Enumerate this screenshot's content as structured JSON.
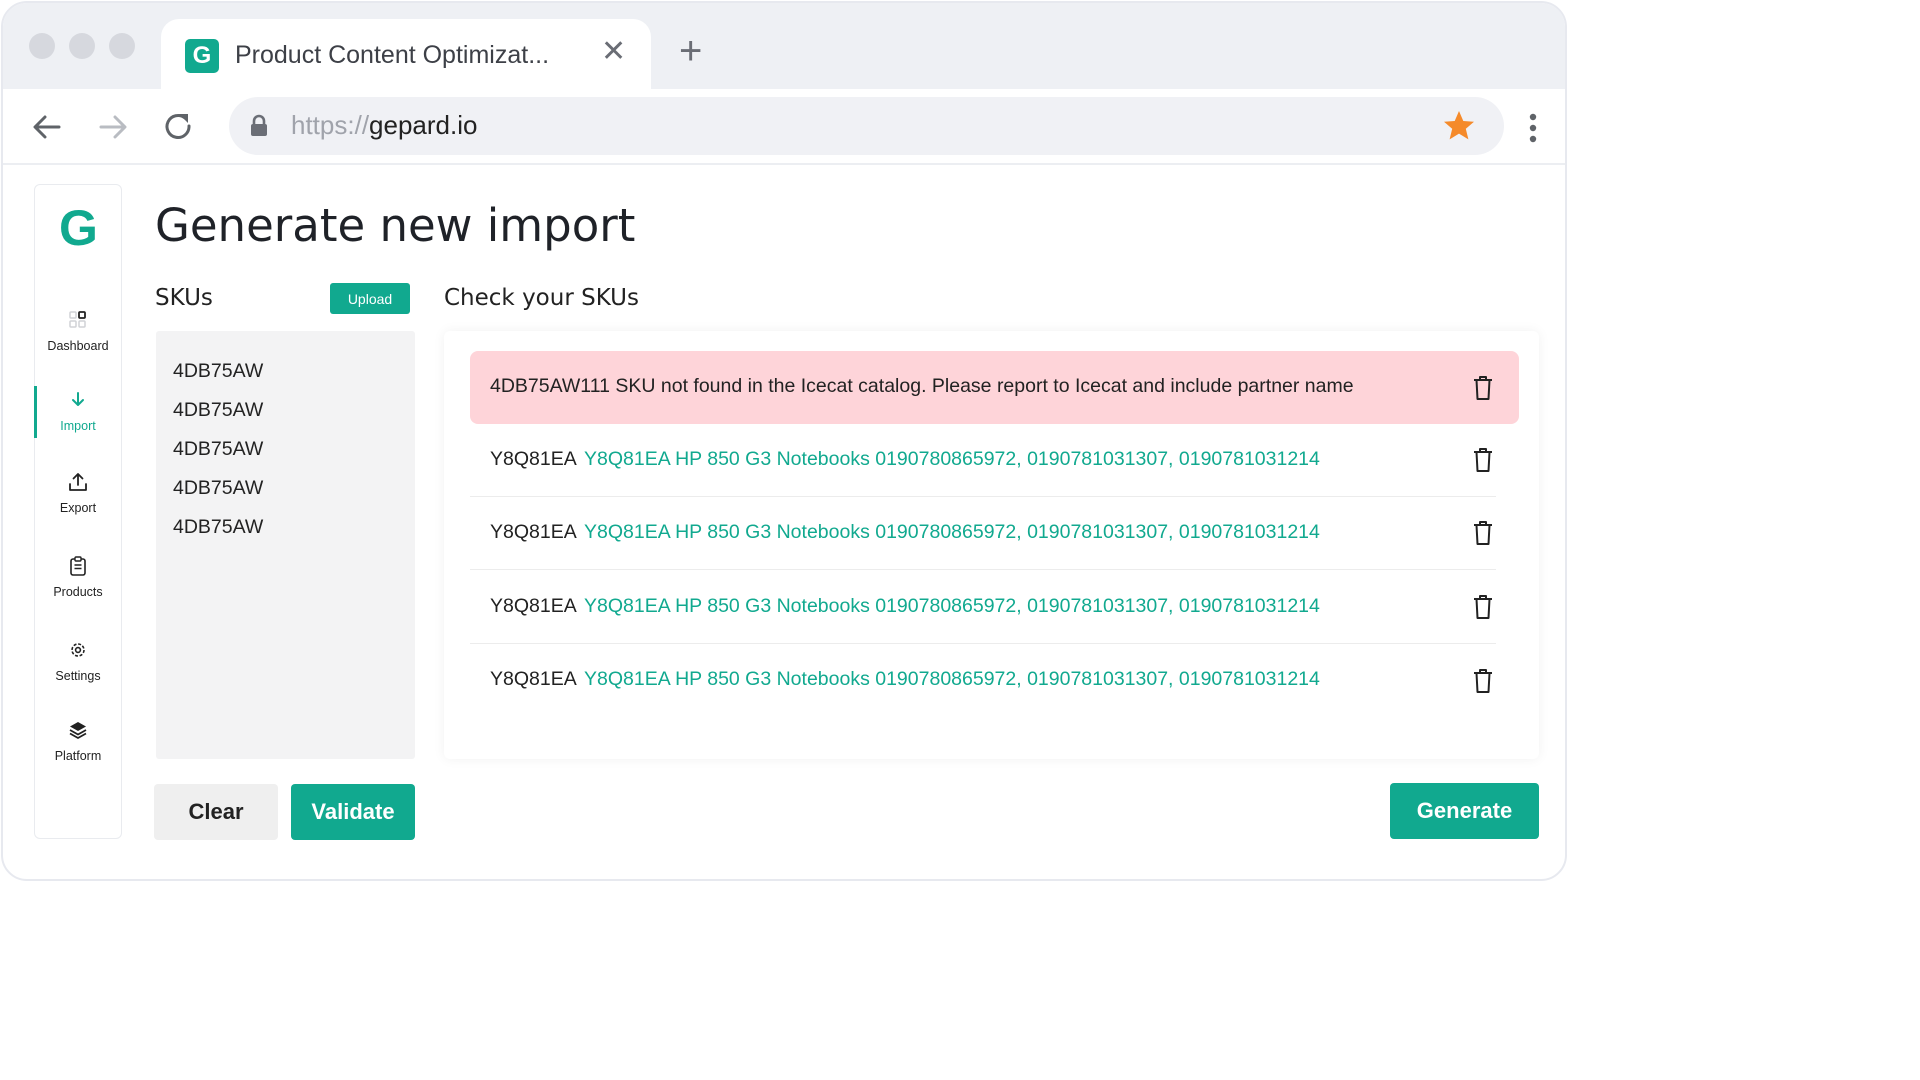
{
  "browser": {
    "tab": {
      "favicon": "G",
      "title": "Product Content Optimizat...",
      "close": "✕"
    },
    "new_tab": "+",
    "url": {
      "scheme": "https://",
      "host": "gepard.io"
    },
    "icons": [
      "back-icon",
      "forward-icon",
      "reload-icon",
      "lock-icon",
      "bookmark-star-icon",
      "menu-dots-icon"
    ],
    "colors": {
      "star": "#f58a2a"
    }
  },
  "sidebar": {
    "logo": "G",
    "items": [
      {
        "label": "Dashboard",
        "icon": "dashboard-icon"
      },
      {
        "label": "Import",
        "icon": "import-arrow-icon",
        "active": true
      },
      {
        "label": "Export",
        "icon": "export-icon"
      },
      {
        "label": "Products",
        "icon": "clipboard-icon"
      },
      {
        "label": "Settings",
        "icon": "gear-icon"
      },
      {
        "label": "Platform",
        "icon": "layers-icon"
      }
    ]
  },
  "main": {
    "title": "Generate new import",
    "skus_label": "SKUs",
    "upload_label": "Upload",
    "sku_list": [
      "4DB75AW",
      "4DB75AW",
      "4DB75AW",
      "4DB75AW",
      "4DB75AW"
    ],
    "check_label": "Check your SKUs",
    "error_message": "4DB75AW111 SKU not found in the Icecat catalog. Please report to Icecat and include partner name",
    "results": [
      {
        "sku": "Y8Q81EA",
        "info": "Y8Q81EA HP 850 G3 Notebooks 0190780865972, 0190781031307, 0190781031214"
      },
      {
        "sku": "Y8Q81EA",
        "info": "Y8Q81EA HP 850 G3 Notebooks 0190780865972, 0190781031307, 0190781031214"
      },
      {
        "sku": "Y8Q81EA",
        "info": "Y8Q81EA HP 850 G3 Notebooks 0190780865972, 0190781031307, 0190781031214"
      },
      {
        "sku": "Y8Q81EA",
        "info": "Y8Q81EA HP 850 G3 Notebooks 0190780865972, 0190781031307, 0190781031214"
      }
    ],
    "clear_label": "Clear",
    "validate_label": "Validate",
    "generate_label": "Generate"
  },
  "colors": {
    "accent": "#11a98f",
    "error_bg": "#fed4d9"
  }
}
